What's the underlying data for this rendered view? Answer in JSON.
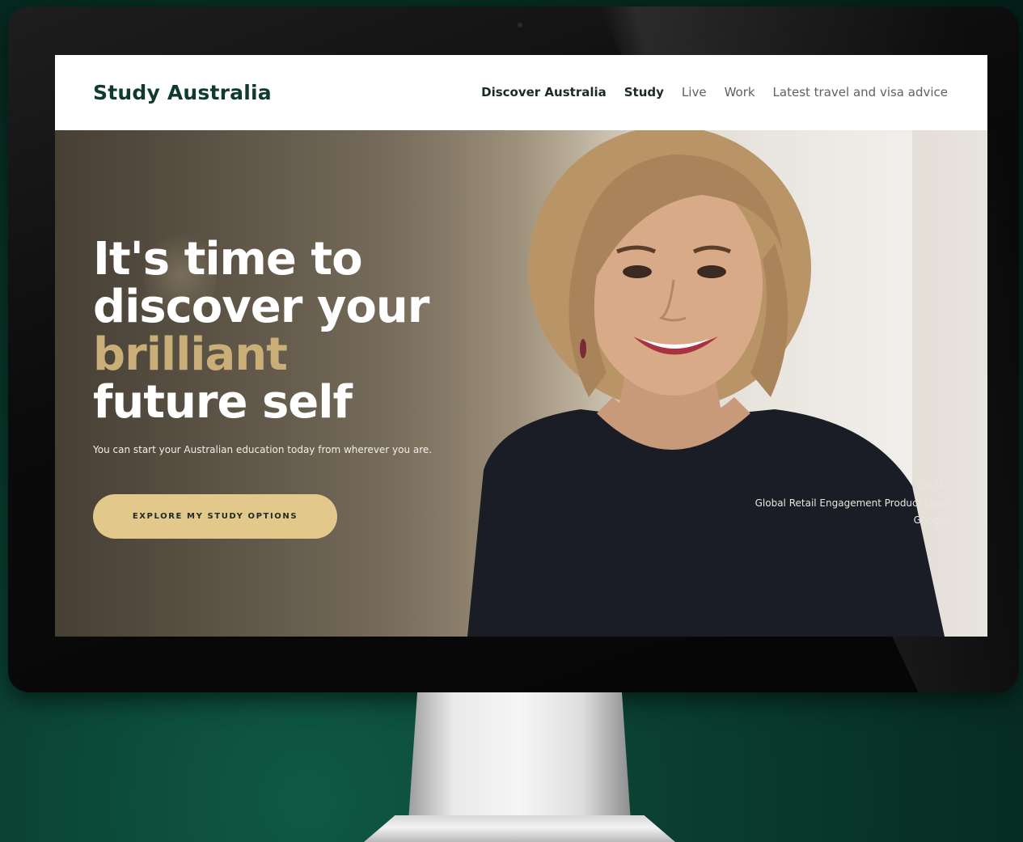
{
  "header": {
    "brand": "Study Australia",
    "nav": [
      {
        "label": "Discover Australia",
        "active": true
      },
      {
        "label": "Study",
        "active": true
      },
      {
        "label": "Live",
        "active": false
      },
      {
        "label": "Work",
        "active": false
      },
      {
        "label": "Latest travel and visa advice",
        "active": false
      }
    ]
  },
  "hero": {
    "headline_line1": "It's time to",
    "headline_line2": "discover your",
    "headline_accent": "brilliant",
    "headline_line4": "future self",
    "subtext": "You can start your Australian education today from wherever you are.",
    "cta_label": "EXPLORE MY STUDY OPTIONS",
    "caption": {
      "name": "Chi Vu",
      "title": "Global Retail Engagement Product Lead",
      "company": "Google"
    }
  },
  "colors": {
    "brand_green": "#0f3b2f",
    "accent_gold": "#c9ae78",
    "cta_background": "#e3c88b",
    "page_background": "#0a3f31"
  }
}
